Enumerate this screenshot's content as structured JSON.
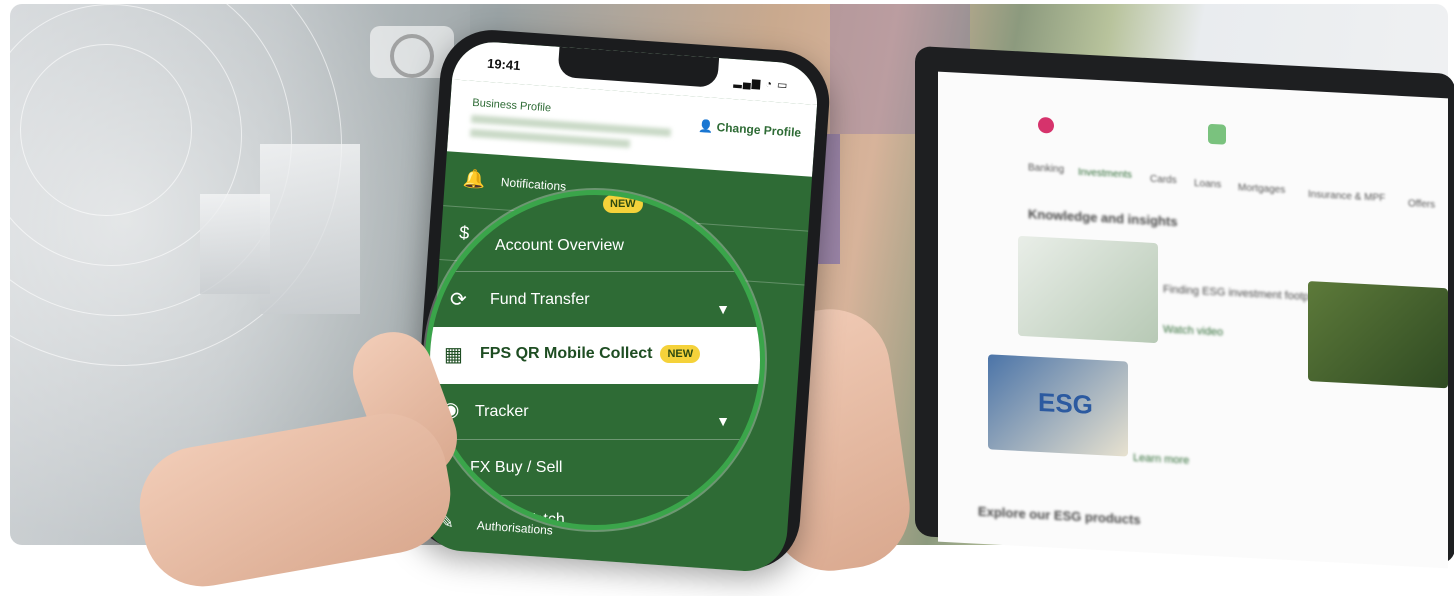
{
  "phone": {
    "time": "19:41",
    "signal": "▂▄▆ ◔ ▭",
    "business_profile_label": "Business Profile",
    "change_profile_label": "Change Profile",
    "menu": [
      {
        "icon": "bell-icon",
        "glyph": "🔔",
        "label": "Notifications"
      },
      {
        "icon": "dollar-icon",
        "glyph": "$",
        "label": ""
      }
    ],
    "bottom_item": {
      "icon": "gavel-icon",
      "glyph": "✎",
      "label": "Authorisations"
    }
  },
  "magnifier": {
    "items": [
      {
        "icon": "",
        "label": "Account Overview",
        "chevron": ""
      },
      {
        "icon": "transfer-icon",
        "glyph": "⟳",
        "label": "Fund Transfer",
        "chevron": "▼"
      },
      {
        "icon": "qr-icon",
        "glyph": "▦",
        "label": "FPS QR Mobile Collect",
        "badge": "NEW",
        "chevron": ""
      },
      {
        "icon": "location-icon",
        "glyph": "◉",
        "label": "Tracker",
        "chevron": "▼"
      },
      {
        "icon": "",
        "label": "FX Buy / Sell",
        "chevron": ""
      },
      {
        "icon": "search-icon",
        "glyph": "⌕",
        "label": "Watch",
        "chevron": "▼"
      }
    ],
    "partial_badge": "NEW"
  },
  "laptop": {
    "tabs": [
      "Banking",
      "Investments",
      "Cards",
      "Loans",
      "Mortgages",
      "Insurance & MPF",
      "Offers"
    ],
    "section_title": "Knowledge and insights",
    "card1_title": "Finding ESG investment footprint",
    "card1_link": "Watch video",
    "card2_title": "ESG",
    "card2_link": "Learn more",
    "bottom_title": "Explore our ESG products",
    "colors": {
      "green": "#2e6b35",
      "accent": "#3aa54a",
      "badge": "#f5d23a"
    }
  }
}
